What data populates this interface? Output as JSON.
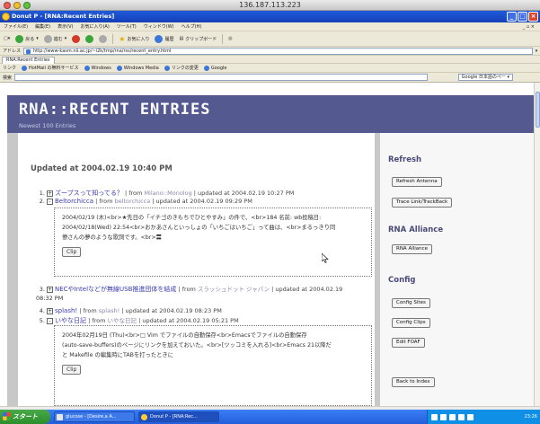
{
  "mac": {
    "title": "136.187.113.223"
  },
  "window": {
    "title": "Donut P - [RNA:Recent Entries]"
  },
  "menu": [
    "ファイル(E)",
    "編集(E)",
    "表示(V)",
    "お気に入り(A)",
    "ツール(T)",
    "ウィンドウ(W)",
    "ヘルプ(H)"
  ],
  "toolbar": {
    "back": "戻る",
    "forward": "進む",
    "favorites": "お気に入り",
    "history": "履歴",
    "clipboard": "クリップボード"
  },
  "address": {
    "label": "アドレス",
    "url": "http://www-kasm.nii.ac.jp/~i2k/tmp/rna/rss/recent_entry.html"
  },
  "tab": {
    "label": "RNA:Recent Entries"
  },
  "links": {
    "label": "リンク",
    "items": [
      "HotMail の無料サービス",
      "Windows",
      "Windows Media",
      "リンクの変更",
      "Google"
    ]
  },
  "search": {
    "label": "検索",
    "engine": "Google 日本語のペー"
  },
  "page": {
    "title": "RNA::RECENT ENTRIES",
    "subtitle": "Newest 100 Entries",
    "updated": "Updated at 2004.02.19 10:40 PM",
    "entries": [
      {
        "num": "1.",
        "toggle": "+",
        "title": "ズープスって知ってる？",
        "from": "| from",
        "source": "Milano::Monolog",
        "meta": "| updated at 2004.02.19 10:27 PM"
      },
      {
        "num": "2.",
        "toggle": "-",
        "title": "Beltorchicca",
        "from": "| from",
        "source": "beltorchicca",
        "meta": "| updated at 2004.02.19 09:29 PM",
        "body": "2004/02/19 (木)<br>★先日の「イチゴのきもちでひとやすみ」の件で、<br>184 名前: wb投稿日: 2004/02/18(Wed) 22:54<br>おかあさんといっしょの「いちごはいちご」って曲は、<br>まるっきり同僚さんの夢のような歌詞です。<br>〓",
        "clip": "Clip"
      },
      {
        "num": "3.",
        "toggle": "+",
        "title": "NECやIntelなどが無線USB推進団体を結成",
        "from": "| from",
        "source": "スラッシュドット ジャパン",
        "meta": "| updated at 2004.02.19",
        "meta2": "08:32 PM"
      },
      {
        "num": "4.",
        "toggle": "+",
        "title": "splash!",
        "from": "| from",
        "source": "splash!",
        "meta": "| updated at 2004.02.19 08:23 PM"
      },
      {
        "num": "5.",
        "toggle": "-",
        "title": "いやな日記",
        "from": "| from",
        "source": "いやな日記",
        "meta": "| updated at 2004.02.19 05:21 PM",
        "body1": "2004年02月19日 (Thu)<br>□ Vim でファイルの自動保存<br>Emacsでファイルの自動保存",
        "body2": "(auto-save-buffers)のページにリンクを加えておいた。<br>[ツッコミを入れる]<br>Emacs 21以降だ",
        "body3": "と Makefile の編集時にTABを打ったときに",
        "clip": "Clip"
      }
    ],
    "body_lines_2": [
      "2004/02/19 (木)<br>★先日の「イチゴのきもちでひとやすみ」の件で、<br>184 名前: wb投稿日:",
      "2004/02/18(Wed) 22:54<br>おかあさんといっしょの「いちごはいちご」って曲は、<br>まるっきり同",
      "僚さんの夢のような歌詞です。<br>〓"
    ]
  },
  "sidebar": {
    "refresh_heading": "Refresh",
    "refresh_antenna": "Refresh Antenna",
    "trace_link": "Trace Link/TrackBack",
    "alliance_heading": "RNA Alliance",
    "alliance_button": "RNA Alliance",
    "config_heading": "Config",
    "config_sites": "Config Sites",
    "config_clips": "Config Clips",
    "edit_foaf": "Edit FOAF",
    "back_to_index": "Back to Index"
  },
  "taskbar": {
    "start": "スタート",
    "tasks": [
      "glucose - [Desire.a A...",
      "Donut P - [RNA:Rec..."
    ],
    "clock": "23:26"
  }
}
